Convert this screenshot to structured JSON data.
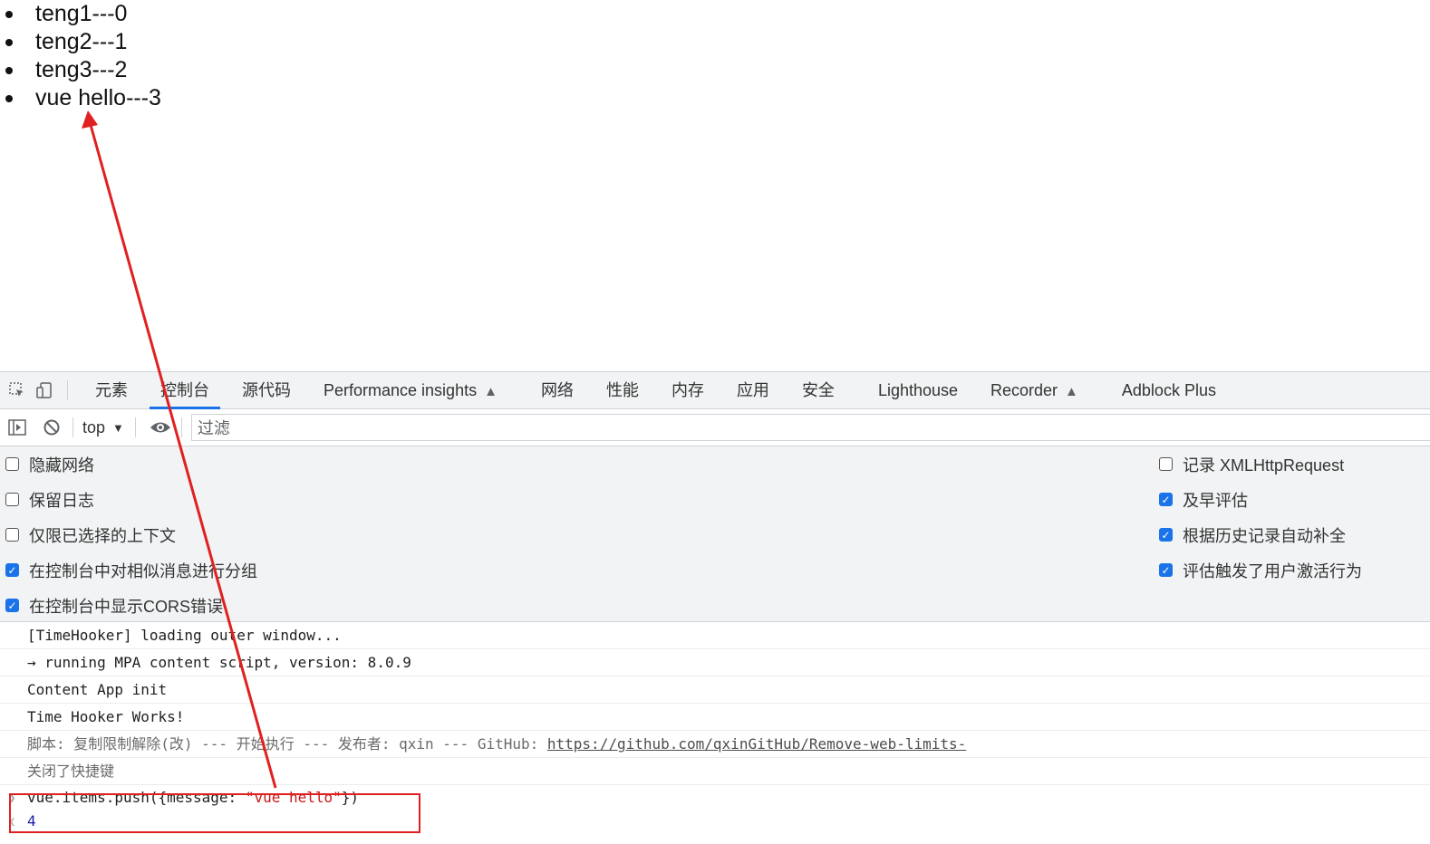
{
  "page": {
    "items": [
      "teng1---0",
      "teng2---1",
      "teng3---2",
      "vue hello---3"
    ]
  },
  "devtools": {
    "tabs": [
      {
        "label": "元素"
      },
      {
        "label": "控制台",
        "active": true
      },
      {
        "label": "源代码"
      },
      {
        "label": "Performance insights",
        "experimental": true
      },
      {
        "label": "网络"
      },
      {
        "label": "性能"
      },
      {
        "label": "内存"
      },
      {
        "label": "应用"
      },
      {
        "label": "安全"
      },
      {
        "label": "Lighthouse"
      },
      {
        "label": "Recorder",
        "experimental": true
      },
      {
        "label": "Adblock Plus"
      }
    ],
    "toolbar": {
      "context": "top",
      "filter_placeholder": "过滤"
    },
    "settings_left": [
      {
        "label": "隐藏网络",
        "checked": false
      },
      {
        "label": "保留日志",
        "checked": false
      },
      {
        "label": "仅限已选择的上下文",
        "checked": false
      },
      {
        "label": "在控制台中对相似消息进行分组",
        "checked": true
      },
      {
        "label": "在控制台中显示CORS错误",
        "checked": true
      }
    ],
    "settings_right": [
      {
        "label": "记录 XMLHttpRequest",
        "checked": false
      },
      {
        "label": "及早评估",
        "checked": true
      },
      {
        "label": "根据历史记录自动补全",
        "checked": true
      },
      {
        "label": "评估触发了用户激活行为",
        "checked": true
      }
    ],
    "console": {
      "messages": [
        "[TimeHooker] loading outer window...",
        "→ running MPA content script, version: 8.0.9",
        "Content App init",
        "Time Hooker Works!"
      ],
      "script_msg": {
        "prefix": "脚本: 复制限制解除(改) --- 开始执行 --- 发布者: qxin --- GitHub: ",
        "link": "https://github.com/qxinGitHub/Remove-web-limits-"
      },
      "shortcut_msg": "关闭了快捷键",
      "input": {
        "code_before": "vue.items.push({message: ",
        "code_string": "\"vue hello\"",
        "code_after": "})"
      },
      "result": "4"
    }
  },
  "colors": {
    "accent": "#1a73e8",
    "annotation": "#e02020"
  }
}
